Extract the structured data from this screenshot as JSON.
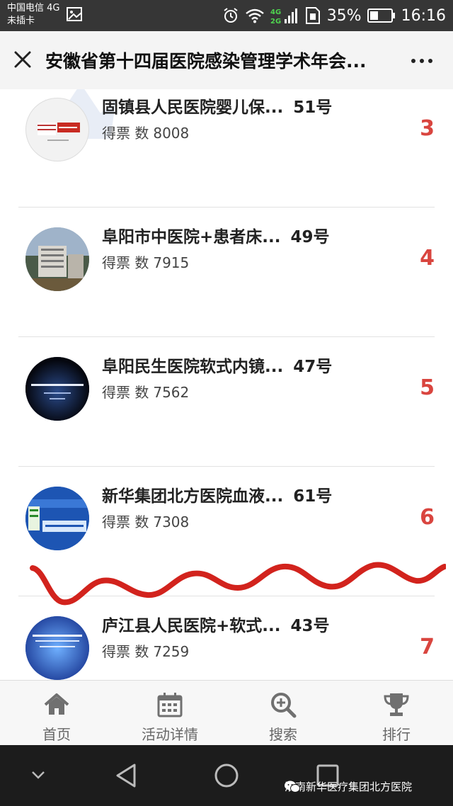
{
  "status_bar": {
    "carrier_line1": "中国电信 4G",
    "carrier_line2": "未插卡",
    "battery": "35%",
    "time": "16:16",
    "network_tag_top": "4G",
    "network_tag_bottom": "2G"
  },
  "nav": {
    "title": "安徽省第十四届医院感染管理学术年会..."
  },
  "list": [
    {
      "name": "固镇县人民医院婴儿保...",
      "number": "51号",
      "votes_label": "得票 数",
      "votes": "8008",
      "rank": "3"
    },
    {
      "name": "阜阳市中医院+患者床...",
      "number": "49号",
      "votes_label": "得票 数",
      "votes": "7915",
      "rank": "4"
    },
    {
      "name": "阜阳民生医院软式内镜...",
      "number": "47号",
      "votes_label": "得票 数",
      "votes": "7562",
      "rank": "5"
    },
    {
      "name": "新华集团北方医院血液...",
      "number": "61号",
      "votes_label": "得票 数",
      "votes": "7308",
      "rank": "6"
    },
    {
      "name": "庐江县人民医院+软式...",
      "number": "43号",
      "votes_label": "得票 数",
      "votes": "7259",
      "rank": "7"
    }
  ],
  "tabs": [
    {
      "label": "首页",
      "icon": "home-icon"
    },
    {
      "label": "活动详情",
      "icon": "calendar-icon"
    },
    {
      "label": "搜索",
      "icon": "search-plus-icon"
    },
    {
      "label": "排行",
      "icon": "trophy-icon"
    }
  ],
  "watermark": "淮南新华医疗集团北方医院",
  "colors": {
    "rank": "#d9453f",
    "scribble": "#d2231d",
    "status_bar": "#363636",
    "nav_bar": "#f4f4f4"
  }
}
